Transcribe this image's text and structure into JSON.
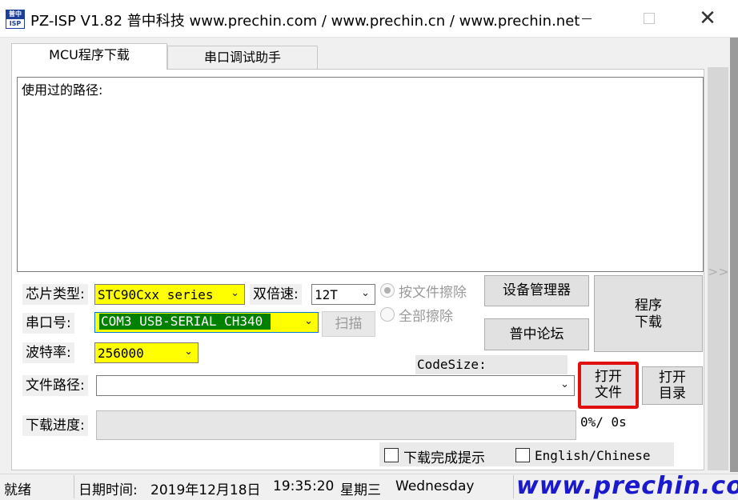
{
  "window": {
    "title": "PZ-ISP V1.82 普中科技  www.prechin.com / www.prechin.cn / www.prechin.net",
    "icon_top": "普中",
    "icon_bottom": "ISP",
    "min_icon": "minimize-icon",
    "max_icon": "maximize-icon",
    "close_glyph": "✕"
  },
  "tabs": [
    {
      "label": "MCU程序下载",
      "active": true
    },
    {
      "label": "串口调试助手",
      "active": false
    }
  ],
  "log": {
    "text": "使用过的路径:"
  },
  "chip": {
    "label": "芯片类型:",
    "value": "STC90Cxx series"
  },
  "speed": {
    "label": "双倍速:",
    "value": "12T"
  },
  "erase": {
    "by_file": "按文件擦除",
    "all": "全部擦除"
  },
  "port": {
    "label": "串口号:",
    "value": "COM3  USB-SERIAL CH340",
    "scan_label": "扫描"
  },
  "baud": {
    "label": "波特率:",
    "value": "256000"
  },
  "buttons": {
    "device_manager": "设备管理器",
    "forum": "普中论坛",
    "program_line1": "程序",
    "program_line2": "下载",
    "open_file_line1": "打开",
    "open_file_line2": "文件",
    "open_dir_line1": "打开",
    "open_dir_line2": "目录"
  },
  "codesize": {
    "label": "CodeSize:"
  },
  "file_path": {
    "label": "文件路径:",
    "value": ""
  },
  "progress": {
    "label": "下载进度:",
    "percent": 0,
    "text": "0%/ 0s"
  },
  "options": {
    "notify_label": "下载完成提示",
    "notify_checked": false,
    "lang_label": "English/Chinese",
    "lang_checked": false
  },
  "status": {
    "ready": "就绪",
    "datetime_label": "日期时间:",
    "date": "2019年12月18日",
    "time": "19:35:20",
    "weekday": "星期三",
    "weekday_en": "Wednesday"
  },
  "watermark": "www.prechin.com",
  "colors": {
    "highlight": "#ffff00",
    "selection": "#008000",
    "red_outline": "#e01010",
    "watermark": "#1a1acc"
  }
}
